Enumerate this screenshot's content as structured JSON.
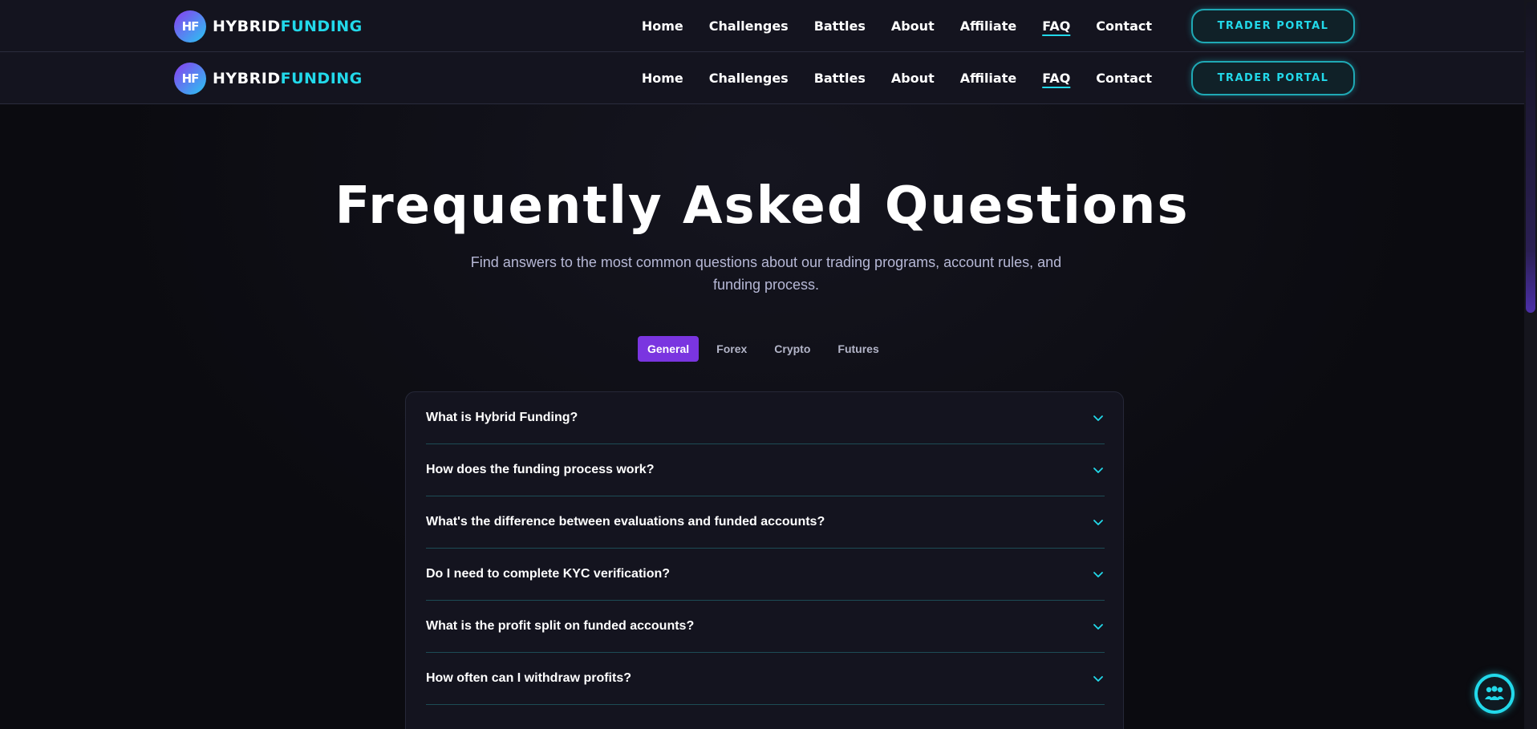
{
  "brand": {
    "badge": "HF",
    "name_part1": "HYBRID",
    "name_part2": "FUNDING"
  },
  "nav": {
    "links": [
      "Home",
      "Challenges",
      "Battles",
      "About",
      "Affiliate",
      "FAQ",
      "Contact"
    ],
    "active": "FAQ",
    "portal_label": "TRADER PORTAL"
  },
  "hero": {
    "title": "Frequently Asked Questions",
    "subtitle": "Find answers to the most common questions about our trading programs, account rules, and funding process."
  },
  "tabs": {
    "items": [
      "General",
      "Forex",
      "Crypto",
      "Futures"
    ],
    "active": "General"
  },
  "faq": {
    "questions": [
      "What is Hybrid Funding?",
      "How does the funding process work?",
      "What's the difference between evaluations and funded accounts?",
      "Do I need to complete KYC verification?",
      "What is the profit split on funded accounts?",
      "How often can I withdraw profits?"
    ]
  },
  "colors": {
    "accent_cyan": "#22d9ea",
    "accent_purple": "#7a35e0",
    "nav_bg": "#14141f",
    "page_bg": "#0b0b10"
  },
  "icons": {
    "chevron": "chevron-down-icon",
    "chat": "support-chat-icon"
  }
}
